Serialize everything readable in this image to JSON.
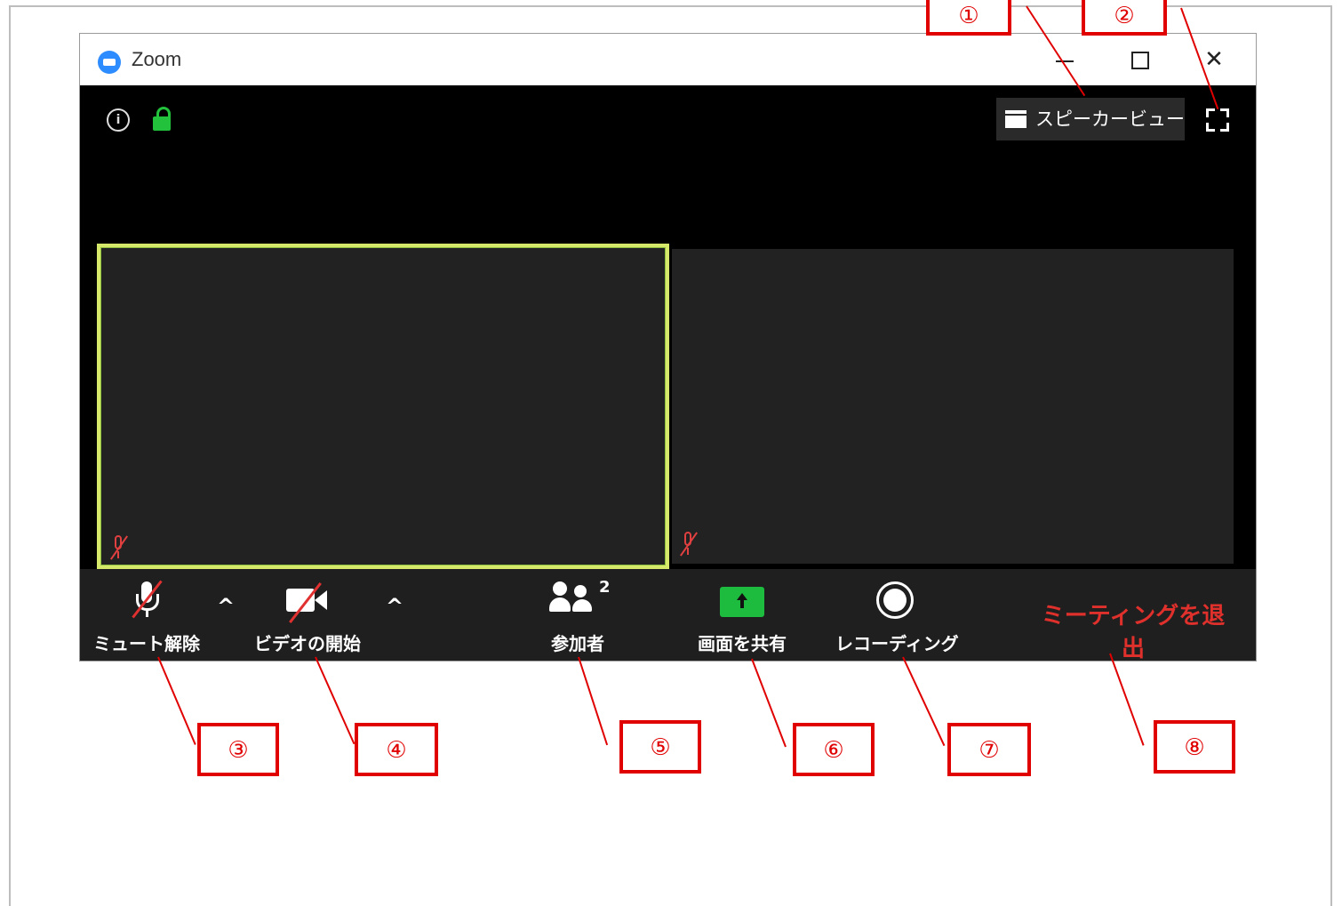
{
  "window": {
    "title": "Zoom",
    "controls": {
      "minimize": "—",
      "maximize": "□",
      "close": "✕"
    }
  },
  "meeting": {
    "info_icon": "info-icon",
    "lock_icon": "lock-icon",
    "speaker_view_label": "スピーカービュー",
    "fullscreen_icon": "fullscreen-icon",
    "tiles": [
      {
        "active_speaker": true,
        "muted": true
      },
      {
        "active_speaker": false,
        "muted": true
      }
    ]
  },
  "toolbar": {
    "unmute_label": "ミュート解除",
    "start_video_label": "ビデオの開始",
    "participants_label": "参加者",
    "participants_count": "2",
    "share_screen_label": "画面を共有",
    "recording_label": "レコーディング",
    "leave_label": "ミーティングを退出",
    "caret": "^"
  },
  "annotations": [
    "①",
    "②",
    "③",
    "④",
    "⑤",
    "⑥",
    "⑦",
    "⑧"
  ],
  "colors": {
    "annotation_red": "#e00000",
    "leave_red": "#e0302c",
    "share_green": "#1dbb3e",
    "lock_green": "#23c23c",
    "active_border": "#d6e86a"
  }
}
